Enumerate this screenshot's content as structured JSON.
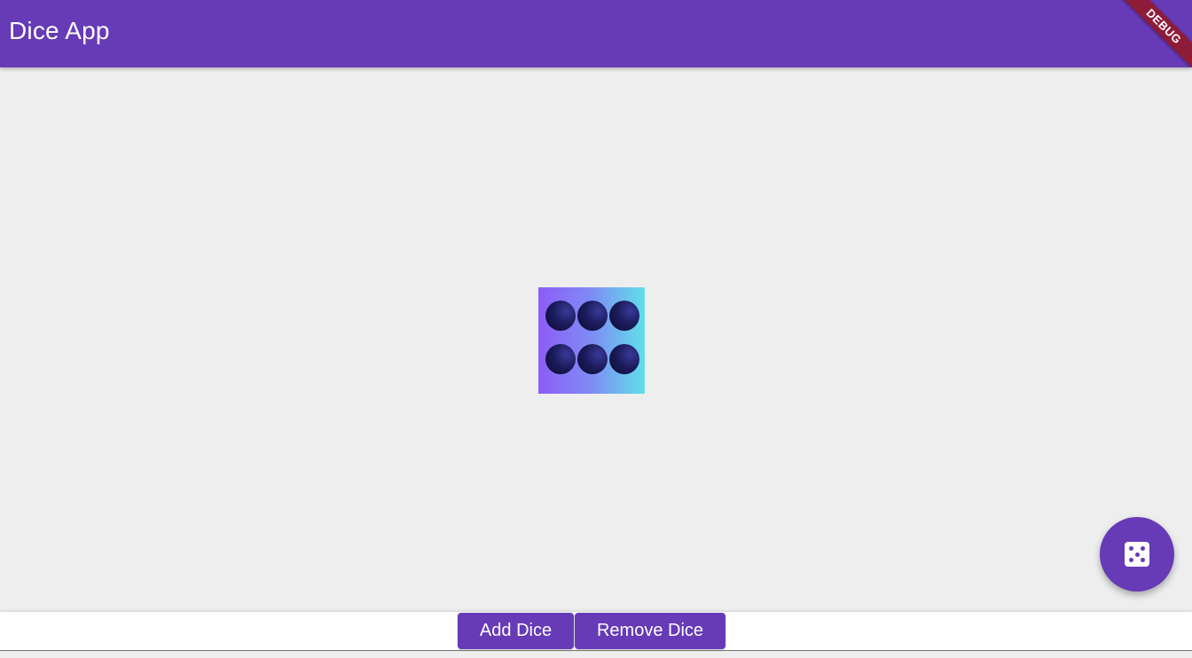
{
  "app_bar": {
    "title": "Dice App",
    "background": "#673ab7"
  },
  "debug_banner": {
    "label": "DEBUG",
    "color": "#8e1b38"
  },
  "dice": {
    "value": 6,
    "pips": 6,
    "gradient_colors": [
      "#8d5cf6",
      "#5fe0e8"
    ],
    "pip_color": "#1c1c5e"
  },
  "fab": {
    "icon": "dice-icon",
    "background": "#673ab7"
  },
  "bottom_bar": {
    "add_label": "Add Dice",
    "remove_label": "Remove Dice"
  },
  "colors": {
    "primary": "#673ab7",
    "body_background": "#eeeeee"
  }
}
